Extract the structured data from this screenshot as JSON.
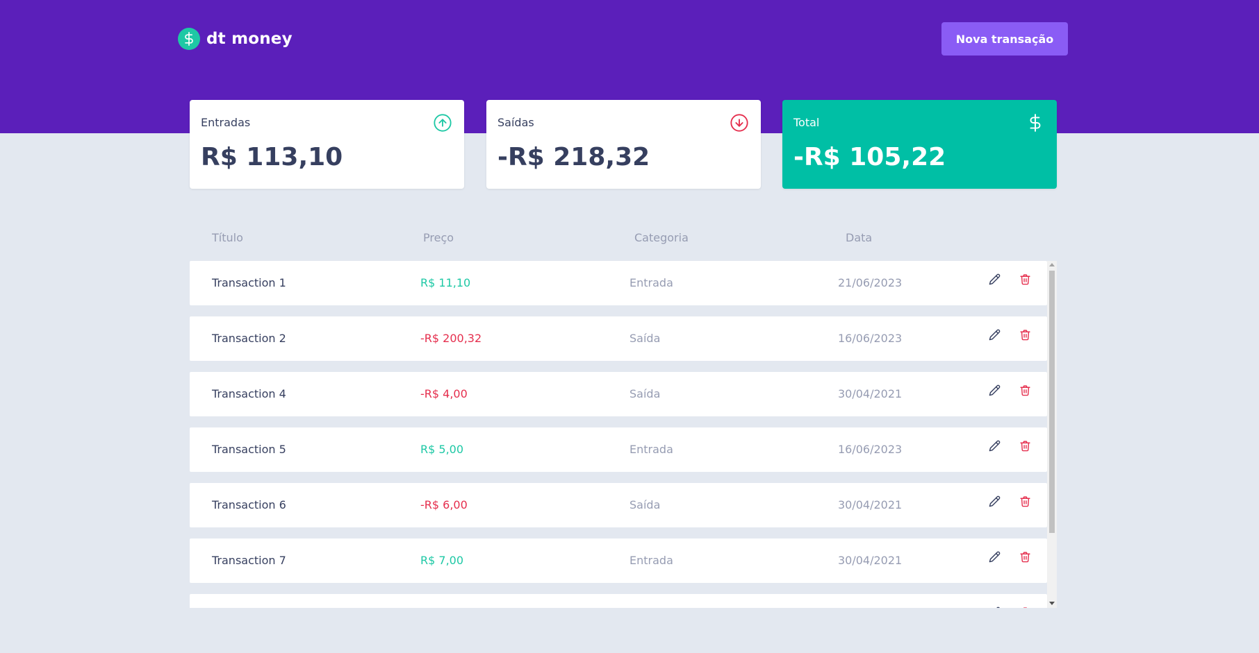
{
  "app": {
    "logo_text": "dt money",
    "logo_icon": "dollar-sign-icon"
  },
  "header": {
    "new_transaction_label": "Nova transação"
  },
  "colors": {
    "header_bg": "#5b1fba",
    "button_bg": "#8a5cf5",
    "green": "#1ec8a5",
    "total_card": "#00bfa5",
    "red": "#e52e4d",
    "text": "#363f5f",
    "muted": "#969cb2",
    "page_bg": "#e3e8f0"
  },
  "summary": {
    "income": {
      "label": "Entradas",
      "value": "R$ 113,10",
      "icon": "arrow-up-circle-icon"
    },
    "outcome": {
      "label": "Saídas",
      "value": "-R$ 218,32",
      "icon": "arrow-down-circle-icon"
    },
    "total": {
      "label": "Total",
      "value": "-R$ 105,22",
      "icon": "dollar-sign-icon"
    }
  },
  "table": {
    "headers": [
      "Título",
      "Preço",
      "Categoria",
      "Data"
    ],
    "rows": [
      {
        "title": "Transaction 1",
        "price": "R$ 11,10",
        "type": "deposit",
        "category": "Entrada",
        "date": "21/06/2023"
      },
      {
        "title": "Transaction 2",
        "price": "-R$ 200,32",
        "type": "withdraw",
        "category": "Saída",
        "date": "16/06/2023"
      },
      {
        "title": "Transaction 4",
        "price": "-R$ 4,00",
        "type": "withdraw",
        "category": "Saída",
        "date": "30/04/2021"
      },
      {
        "title": "Transaction 5",
        "price": "R$ 5,00",
        "type": "deposit",
        "category": "Entrada",
        "date": "16/06/2023"
      },
      {
        "title": "Transaction 6",
        "price": "-R$ 6,00",
        "type": "withdraw",
        "category": "Saída",
        "date": "30/04/2021"
      },
      {
        "title": "Transaction 7",
        "price": "R$ 7,00",
        "type": "deposit",
        "category": "Entrada",
        "date": "30/04/2021"
      },
      {
        "title": "",
        "price": "",
        "type": "deposit",
        "category": "",
        "date": ""
      }
    ],
    "row_actions": {
      "edit_icon": "pencil-icon",
      "delete_icon": "trash-icon"
    }
  }
}
